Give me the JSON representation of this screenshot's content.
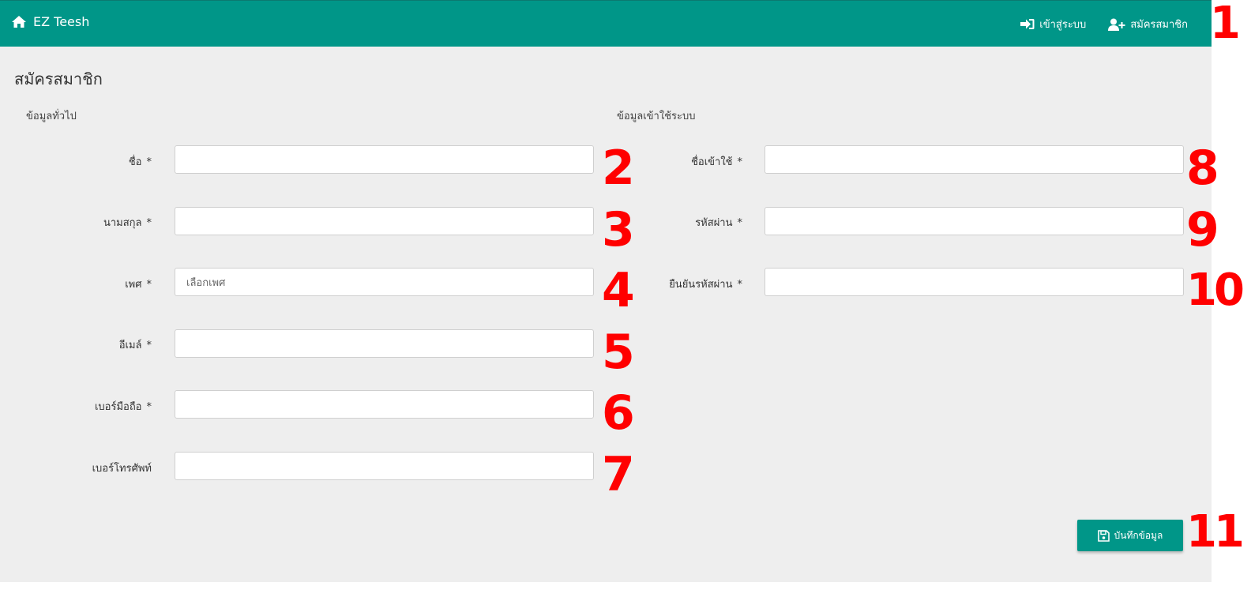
{
  "navbar": {
    "brand": "EZ Teesh",
    "login_label": "เข้าสู่ระบบ",
    "register_label": "สมัครสมาชิก",
    "bg_color": "#009688"
  },
  "page": {
    "title": "สมัครสมาชิก"
  },
  "sections": {
    "general": "ข้อมูลทั่วไป",
    "login": "ข้อมูลเข้าใช้ระบบ"
  },
  "general_fields": {
    "first_name_label": "ชื่อ",
    "last_name_label": "นามสกุล",
    "gender_label": "เพศ",
    "gender_value": "เลือกเพศ",
    "email_label": "อีเมล์",
    "mobile_label": "เบอร์มือถือ",
    "phone_label": "เบอร์โทรศัพท์"
  },
  "login_fields": {
    "username_label": "ชื่อเข้าใช้",
    "password_label": "รหัสผ่าน",
    "confirm_password_label": "ยืนยันรหัสผ่าน"
  },
  "required_mark": "*",
  "save_button": "บันทึกข้อมูล",
  "annotations": [
    "1",
    "2",
    "3",
    "4",
    "5",
    "6",
    "7",
    "8",
    "9",
    "10",
    "11"
  ]
}
